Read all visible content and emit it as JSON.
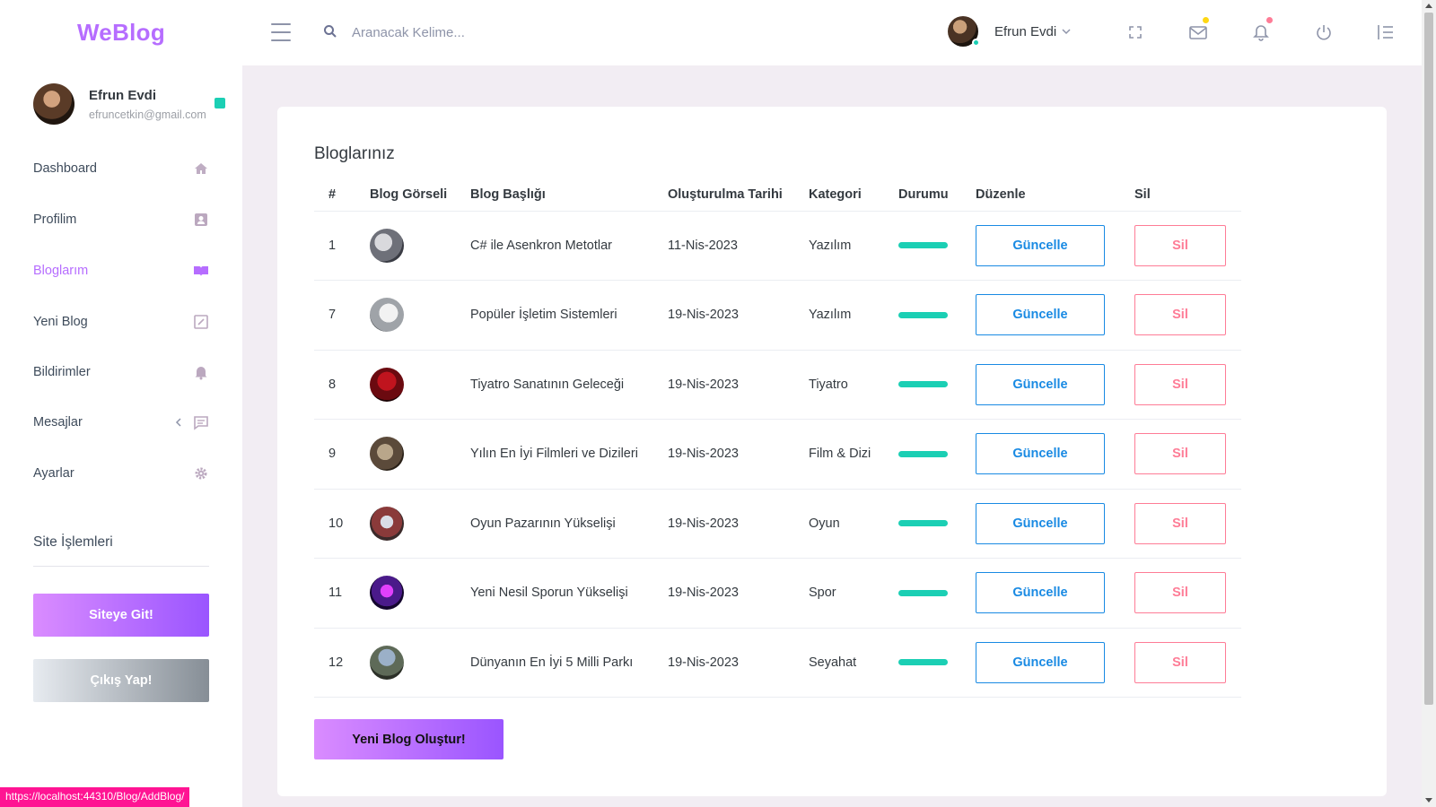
{
  "brand": "WeBlog",
  "search": {
    "placeholder": "Aranacak Kelime..."
  },
  "user": {
    "name": "Efrun Evdi",
    "email": "efruncetkin@gmail.com"
  },
  "sidebar": {
    "items": [
      {
        "label": "Dashboard",
        "icon": "home-icon"
      },
      {
        "label": "Profilim",
        "icon": "contact-card-icon"
      },
      {
        "label": "Bloglarım",
        "icon": "book-open-icon",
        "active": true
      },
      {
        "label": "Yeni Blog",
        "icon": "edit-square-icon"
      },
      {
        "label": "Bildirimler",
        "icon": "bell-ring-icon"
      },
      {
        "label": "Mesajlar",
        "icon": "message-icon"
      },
      {
        "label": "Ayarlar",
        "icon": "gear-icon"
      }
    ],
    "section_title": "Site İşlemleri",
    "site_button": "Siteye Git!",
    "logout_button": "Çıkış Yap!"
  },
  "main": {
    "title": "Bloglarınız",
    "columns": [
      "#",
      "Blog Görseli",
      "Blog Başlığı",
      "Oluşturulma Tarihi",
      "Kategori",
      "Durumu",
      "Düzenle",
      "Sil"
    ],
    "rows": [
      {
        "id": "1",
        "title": "C# ile Asenkron Metotlar",
        "date": "11-Nis-2023",
        "category": "Yazılım"
      },
      {
        "id": "7",
        "title": "Popüler İşletim Sistemleri",
        "date": "19-Nis-2023",
        "category": "Yazılım"
      },
      {
        "id": "8",
        "title": "Tiyatro Sanatının Geleceği",
        "date": "19-Nis-2023",
        "category": "Tiyatro"
      },
      {
        "id": "9",
        "title": "Yılın En İyi Filmleri ve Dizileri",
        "date": "19-Nis-2023",
        "category": "Film & Dizi"
      },
      {
        "id": "10",
        "title": "Oyun Pazarının Yükselişi",
        "date": "19-Nis-2023",
        "category": "Oyun"
      },
      {
        "id": "11",
        "title": "Yeni Nesil Sporun Yükselişi",
        "date": "19-Nis-2023",
        "category": "Spor"
      },
      {
        "id": "12",
        "title": "Dünyanın En İyi 5 Milli Parkı",
        "date": "19-Nis-2023",
        "category": "Seyahat"
      }
    ],
    "update_label": "Güncelle",
    "delete_label": "Sil",
    "new_blog_button": "Yeni Blog Oluştur!"
  },
  "status_url": "https://localhost:44310/Blog/AddBlog/",
  "colors": {
    "accent": "#b66dff",
    "success": "#1bcfb4",
    "info": "#198ae3",
    "danger": "#fe7c96"
  }
}
